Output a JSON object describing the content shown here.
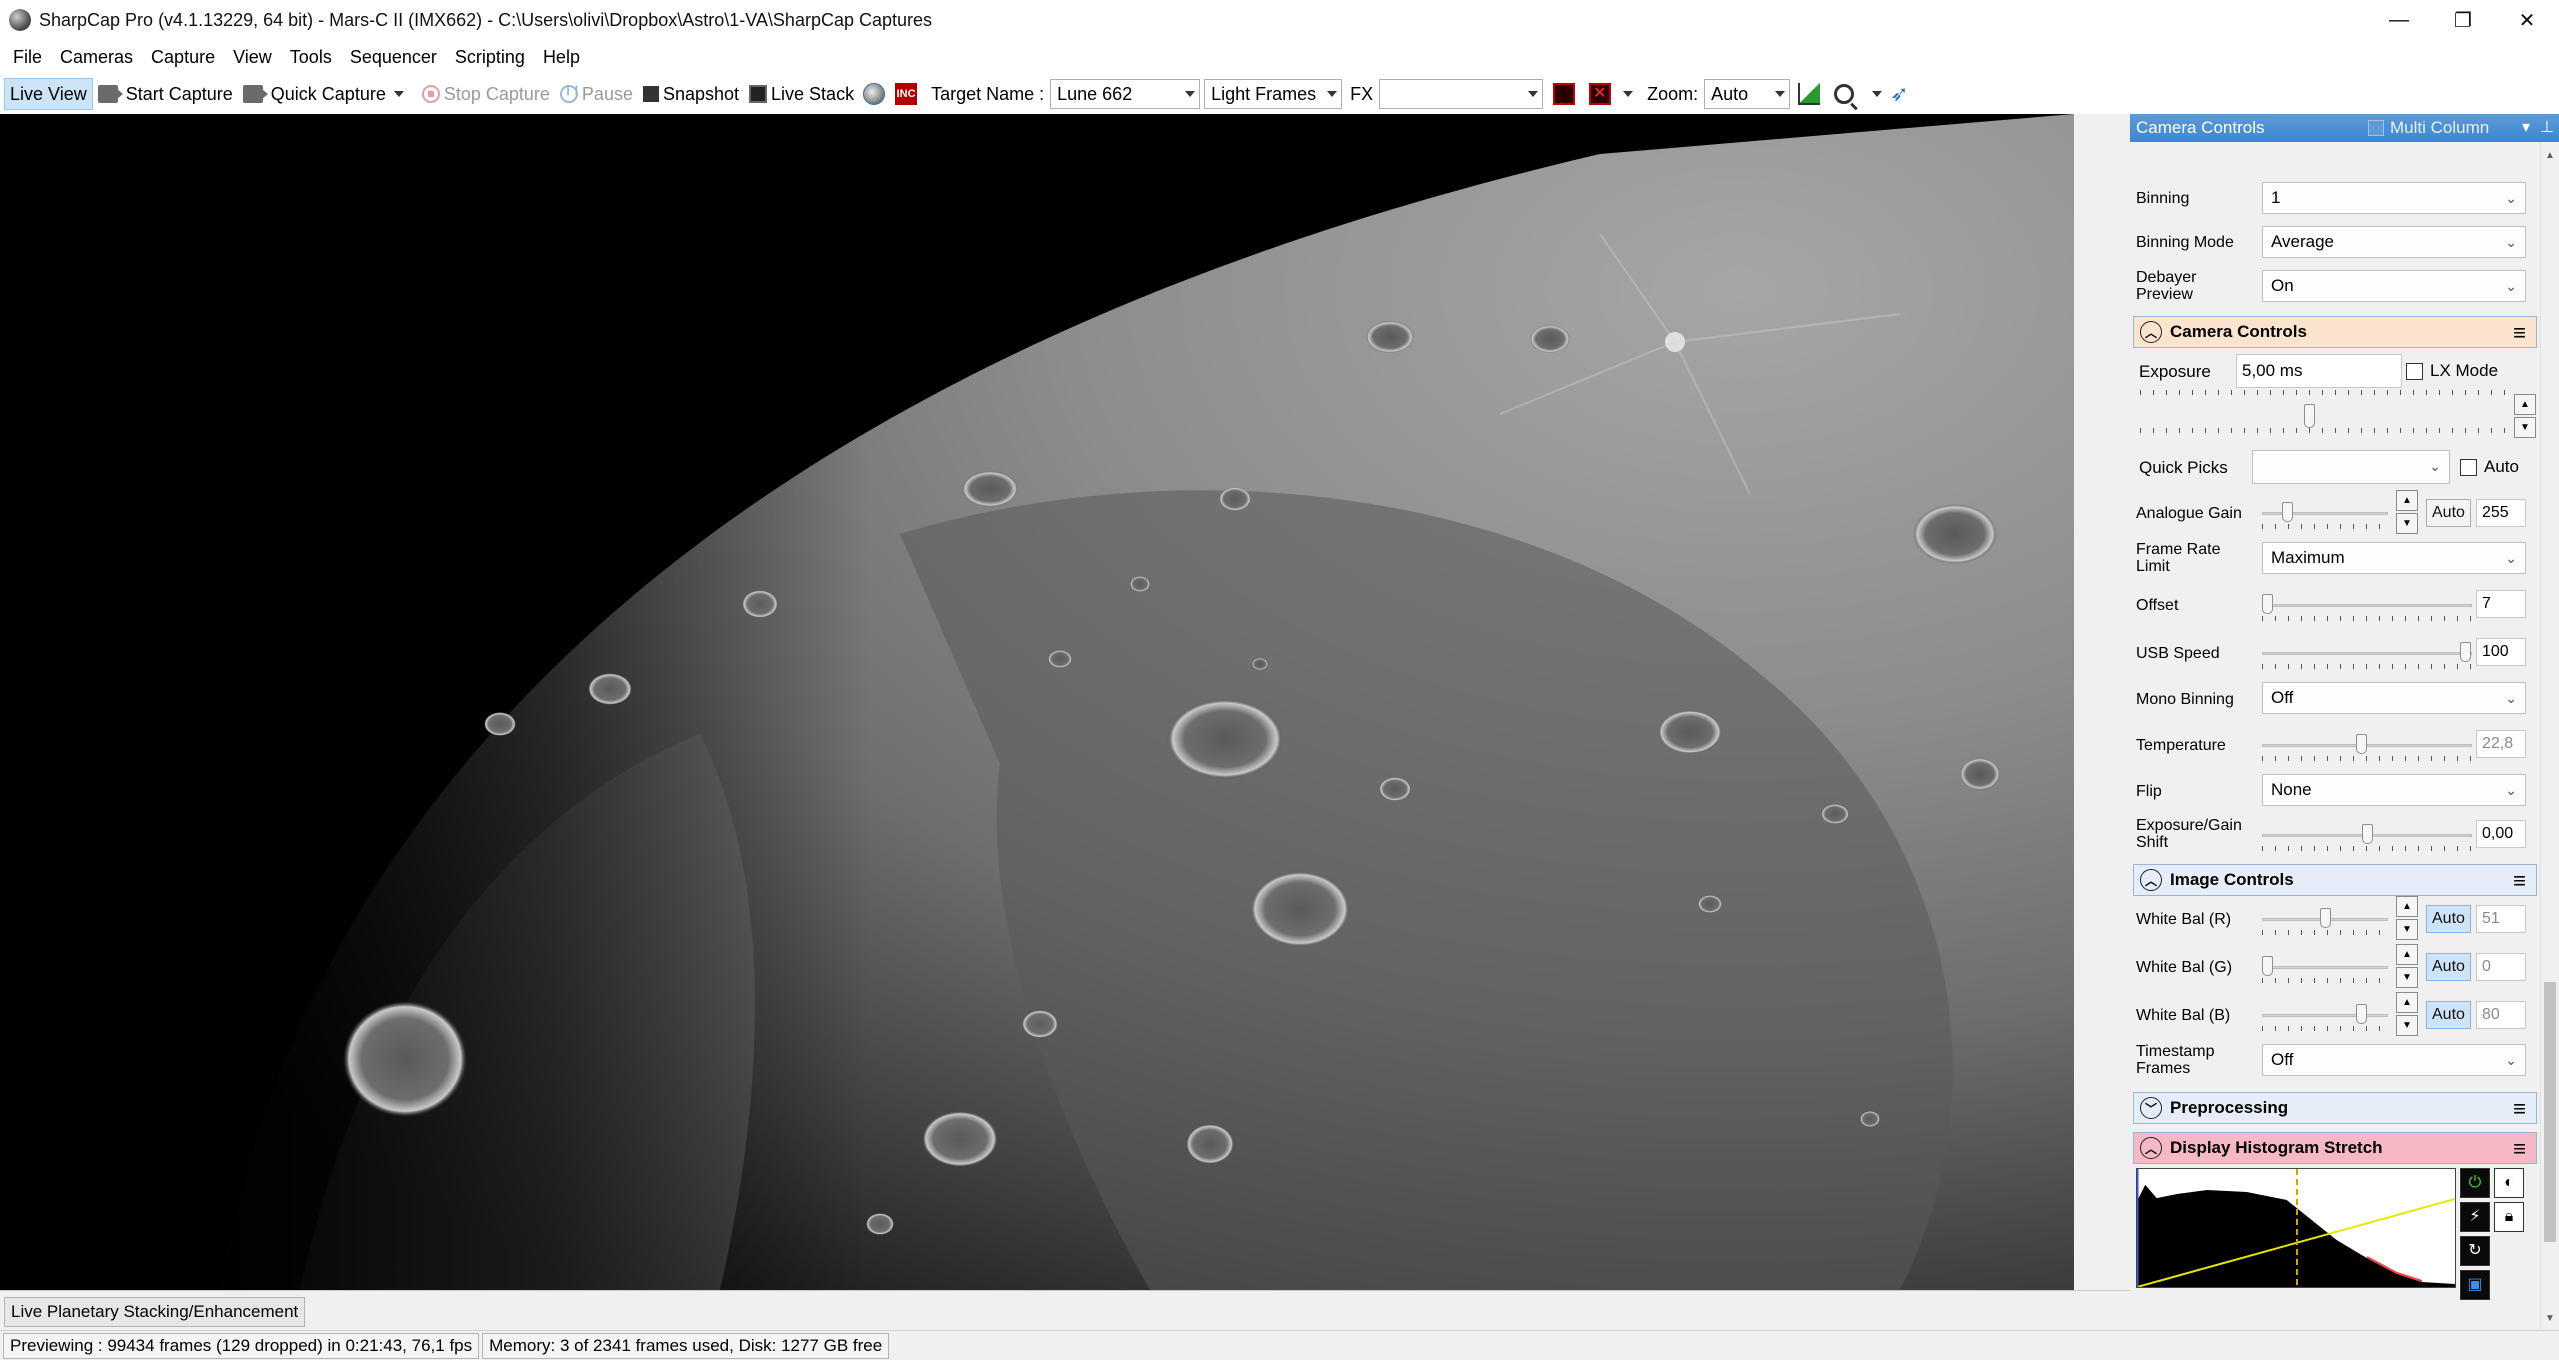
{
  "window": {
    "title": "SharpCap Pro (v4.1.13229, 64 bit) - Mars-C II (IMX662) - C:\\Users\\olivi\\Dropbox\\Astro\\1-VA\\SharpCap Captures",
    "minimize": "—",
    "maximize": "❐",
    "close": "✕"
  },
  "menu": [
    "File",
    "Cameras",
    "Capture",
    "View",
    "Tools",
    "Sequencer",
    "Scripting",
    "Help"
  ],
  "toolbar": {
    "live_view": "Live View",
    "start_capture": "Start Capture",
    "quick_capture": "Quick Capture",
    "stop_capture": "Stop Capture",
    "pause": "Pause",
    "snapshot": "Snapshot",
    "live_stack": "Live Stack",
    "target_name_label": "Target Name :",
    "target_name_value": "Lune 662",
    "frame_type": "Light Frames",
    "fx_label": "FX",
    "fx_value": "",
    "zoom_label": "Zoom:",
    "zoom_value": "Auto",
    "red_icon_text": "INC"
  },
  "panel": {
    "title": "Camera Controls",
    "multi_column": "Multi Column",
    "binning": {
      "label": "Binning",
      "value": "1"
    },
    "binning_mode": {
      "label": "Binning Mode",
      "value": "Average"
    },
    "debayer_preview": {
      "label": "Debayer Preview",
      "value": "On"
    },
    "camera_controls_header": "Camera Controls",
    "exposure": {
      "label": "Exposure",
      "value": "5,00 ms",
      "lx_mode": "LX Mode"
    },
    "quick_picks": {
      "label": "Quick Picks",
      "value": "",
      "auto": "Auto"
    },
    "analogue_gain": {
      "label": "Analogue Gain",
      "auto": "Auto",
      "value": "255",
      "level": 0.18
    },
    "frame_rate_limit": {
      "label": "Frame Rate Limit",
      "value": "Maximum"
    },
    "offset": {
      "label": "Offset",
      "value": "7",
      "level": 0.0
    },
    "usb_speed": {
      "label": "USB Speed",
      "value": "100",
      "level": 1.0
    },
    "mono_binning": {
      "label": "Mono Binning",
      "value": "Off"
    },
    "temperature": {
      "label": "Temperature",
      "value": "22,8",
      "level": 0.45
    },
    "flip": {
      "label": "Flip",
      "value": "None"
    },
    "exposure_gain_shift": {
      "label": "Exposure/Gain Shift",
      "value": "0,00",
      "level": 0.5
    },
    "image_controls_header": "Image Controls",
    "white_bal_r": {
      "label": "White Bal (R)",
      "auto": "Auto",
      "value": "51",
      "level": 0.5
    },
    "white_bal_g": {
      "label": "White Bal (G)",
      "auto": "Auto",
      "value": "0",
      "level": 0.0
    },
    "white_bal_b": {
      "label": "White Bal (B)",
      "auto": "Auto",
      "value": "80",
      "level": 0.8
    },
    "timestamp_frames": {
      "label": "Timestamp Frames",
      "value": "Off"
    },
    "preprocessing_header": "Preprocessing",
    "histogram_header": "Display Histogram Stretch"
  },
  "bottom": {
    "tab": "Live Planetary Stacking/Enhancement",
    "status_preview": "Previewing : 99434 frames (129 dropped) in 0:21:43, 76,1 fps",
    "status_memory": "Memory: 3 of 2341 frames used, Disk: 1277 GB free"
  },
  "colors": {
    "panel_header": "#3f86cf",
    "active_group": "#fbe4cd",
    "histogram_group": "#f6b8c4",
    "auto_button": "#cfe3f7"
  }
}
